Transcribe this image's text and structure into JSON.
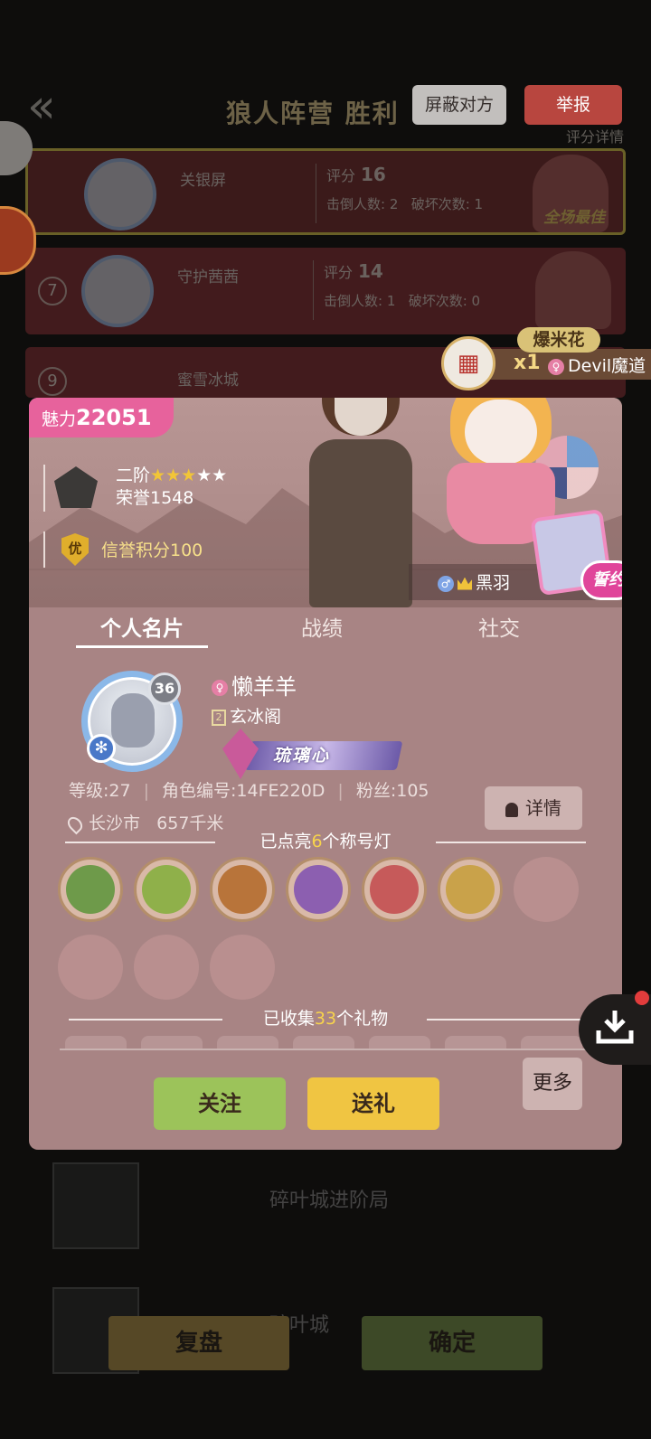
{
  "background": {
    "back_icon": "chevron-double-left-icon",
    "title": "狼人阵营 胜利",
    "subtitle_right": "评分详情",
    "rows": [
      {
        "rank": "",
        "name": "关银屏",
        "score_label": "评分",
        "score": "16",
        "kills_label": "击倒人数:",
        "kills": "2",
        "breaks_label": "破坏次数:",
        "breaks": "1",
        "mvp": "全场最佳"
      },
      {
        "rank": "7",
        "name": "守护茜茜",
        "score_label": "评分",
        "score": "14",
        "kills_label": "击倒人数:",
        "kills": "1",
        "breaks_label": "破坏次数:",
        "breaks": "0"
      },
      {
        "rank": "9",
        "name": "蜜雪冰城"
      }
    ],
    "bottom_rows": [
      "碎叶城进阶局",
      "碎叶城"
    ],
    "replay_label": "复盘",
    "confirm_label": "确定"
  },
  "actions": {
    "block_label": "屏蔽对方",
    "report_label": "举报"
  },
  "gift_notice": {
    "gift_name": "爆米花",
    "count": "x1",
    "sender": "Devil魔道"
  },
  "profile": {
    "charm_label": "魅力",
    "charm_value": "22051",
    "rank_tier": "二阶",
    "rank_stars_on": "★★★",
    "rank_stars_off": "★★",
    "honor": "荣誉1548",
    "credit_badge": "优",
    "credit": "信誉积分100",
    "partner_name": "黑羽",
    "vow_badge": "誓约",
    "tabs": [
      "个人名片",
      "战绩",
      "社交"
    ],
    "avatar_level": "36",
    "name": "懒羊羊",
    "guild_rank": "2",
    "guild": "玄冰阁",
    "title_plate": "琉璃心",
    "level": "等级:27",
    "role_id": "角色编号:14FE220D",
    "fans": "粉丝:105",
    "location": "长沙市",
    "distance": "657千米",
    "detail_label": "详情",
    "lamps_prefix": "已点亮",
    "lamps_count": "6",
    "lamps_suffix": "个称号灯",
    "lamps": [
      {
        "name": "leaf-beast-icon",
        "color": "#6e9a4a"
      },
      {
        "name": "green-dragon-icon",
        "color": "#8fb04a"
      },
      {
        "name": "werewolf-icon",
        "color": "#b8743a"
      },
      {
        "name": "purple-crystal-icon",
        "color": "#8c5fb0"
      },
      {
        "name": "love-letter-icon",
        "color": "#c65a5a"
      },
      {
        "name": "detective-card-icon",
        "color": "#c9a24a"
      }
    ],
    "gifts_prefix": "已收集",
    "gifts_count": "33",
    "gifts_suffix": "个礼物",
    "follow_label": "关注",
    "gift_label": "送礼",
    "more_label": "更多"
  }
}
